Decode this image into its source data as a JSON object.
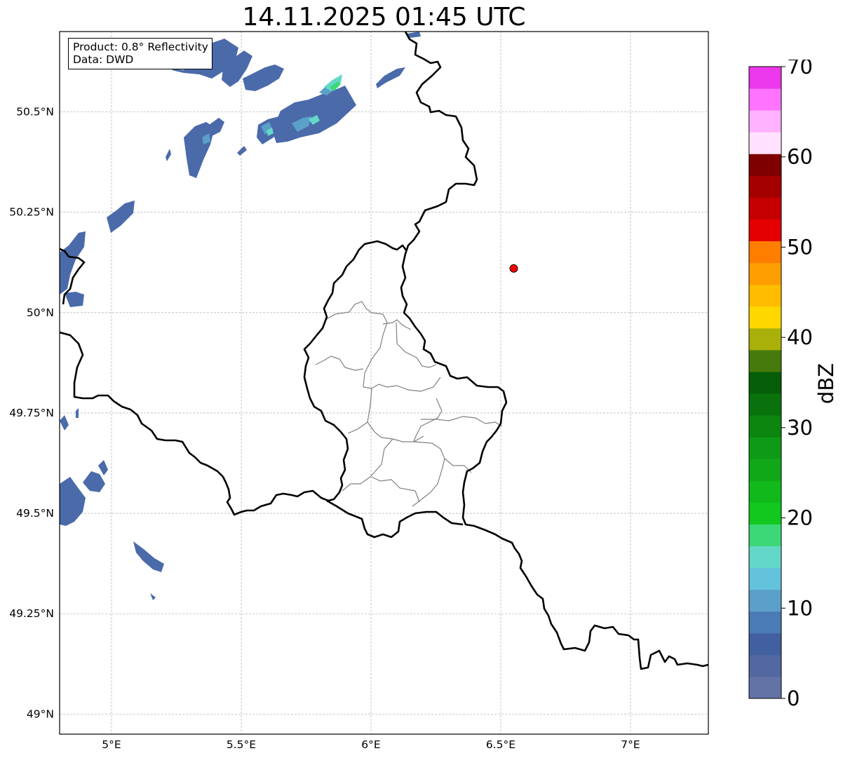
{
  "title": "14.11.2025 01:45 UTC",
  "info_box": {
    "product": "Product: 0.8° Reflectivity",
    "source": "Data: DWD"
  },
  "map": {
    "type": "radar_reflectivity_map",
    "lon_range": [
      4.8,
      7.3
    ],
    "lat_range": [
      48.95,
      50.7
    ],
    "x_ticks": [
      {
        "value": 5.0,
        "label": "5°E"
      },
      {
        "value": 5.5,
        "label": "5.5°E"
      },
      {
        "value": 6.0,
        "label": "6°E"
      },
      {
        "value": 6.5,
        "label": "6.5°E"
      },
      {
        "value": 7.0,
        "label": "7°E"
      }
    ],
    "y_ticks": [
      {
        "value": 49.0,
        "label": "49°N"
      },
      {
        "value": 49.25,
        "label": "49.25°N"
      },
      {
        "value": 49.5,
        "label": "49.5°N"
      },
      {
        "value": 49.75,
        "label": "49.75°N"
      },
      {
        "value": 50.0,
        "label": "50°N"
      },
      {
        "value": 50.25,
        "label": "50.25°N"
      },
      {
        "value": 50.5,
        "label": "50.5°N"
      }
    ],
    "grid": true,
    "marker": {
      "lon": 6.55,
      "lat": 50.11,
      "color": "#ff0000"
    }
  },
  "colorbar": {
    "label": "dBZ",
    "min": 0,
    "max": 70,
    "ticks": [
      0,
      10,
      20,
      30,
      40,
      50,
      60,
      70
    ],
    "colors": [
      "#6473a6",
      "#5367a0",
      "#4260a0",
      "#4a7bb5",
      "#5aa0c8",
      "#64c2dc",
      "#64d8c8",
      "#3cd878",
      "#12c81e",
      "#12b91a",
      "#10a818",
      "#0e9a16",
      "#0c860f",
      "#0a720d",
      "#065e08",
      "#467a0c",
      "#aab00a",
      "#ffd800",
      "#ffbc00",
      "#ff9e00",
      "#ff7e00",
      "#e40000",
      "#c60000",
      "#a40000",
      "#7e0000",
      "#ffe2ff",
      "#ffb2ff",
      "#ff74ff",
      "#ec38ec"
    ]
  }
}
